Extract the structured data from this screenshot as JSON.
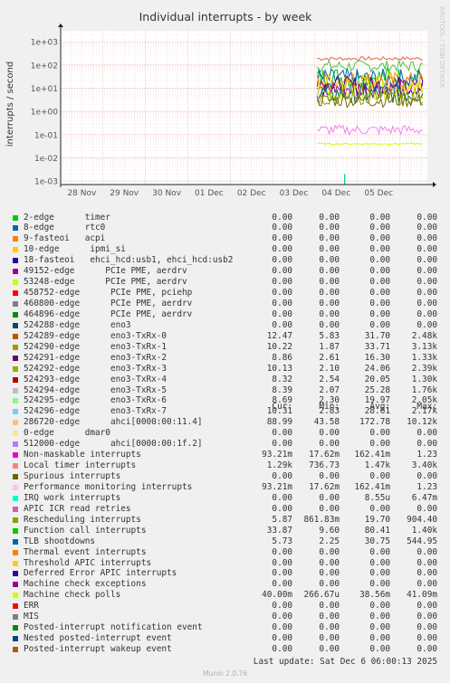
{
  "chart_data": {
    "type": "line",
    "title": "Individual interrupts - by week",
    "ylabel": "interrupts / second",
    "yscale": "log",
    "ylim": [
      0.0007,
      3000
    ],
    "yticks": [
      "1e+03",
      "1e+02",
      "1e+01",
      "1e+00",
      "1e-01",
      "1e-02",
      "1e-03"
    ],
    "ytick_values": [
      1000,
      100,
      10,
      1,
      0.1,
      0.01,
      0.001
    ],
    "xticks": [
      "28 Nov",
      "29 Nov",
      "30 Nov",
      "01 Dec",
      "02 Dec",
      "03 Dec",
      "04 Dec",
      "05 Dec"
    ],
    "x_day_range": [
      0,
      8.65
    ],
    "data_start_day": 6.05,
    "watermark": "RRDTOOL / TOBI OETIKER",
    "grid": true,
    "series": [
      {
        "level": 190,
        "spread": 0.08,
        "color": "#EA644A"
      },
      {
        "level": 90,
        "spread": 0.25,
        "color": "#4DC24D"
      },
      {
        "level": 30,
        "spread": 0.45,
        "color": "#00CC00"
      },
      {
        "level": 25,
        "spread": 0.45,
        "color": "#0066B3"
      },
      {
        "level": 20,
        "spread": 0.4,
        "color": "#FF8000"
      },
      {
        "level": 15,
        "spread": 0.45,
        "color": "#FFCC00"
      },
      {
        "level": 12,
        "spread": 0.45,
        "color": "#330099"
      },
      {
        "level": 10,
        "spread": 0.4,
        "color": "#990099"
      },
      {
        "level": 8,
        "spread": 0.4,
        "color": "#CCFF00"
      },
      {
        "level": 6,
        "spread": 0.45,
        "color": "#006666"
      },
      {
        "level": 4,
        "spread": 0.35,
        "color": "#999900"
      },
      {
        "level": 3,
        "spread": 0.3,
        "color": "#6E6E00"
      },
      {
        "level": 0.16,
        "spread": 0.22,
        "color": "#EE82EE"
      },
      {
        "level": 0.04,
        "spread": 0.03,
        "color": "#CCFF00"
      }
    ],
    "spike": {
      "day": 6.7,
      "value": 0.002,
      "color": "#00CC99"
    }
  },
  "legend": {
    "headers": [
      "Cur:",
      "Min:",
      "Avg:",
      "Max:"
    ],
    "rows": [
      {
        "name": "2-edge      timer",
        "color": "#00CC00",
        "cur": "0.00",
        "min": "0.00",
        "avg": "0.00",
        "max": "0.00"
      },
      {
        "name": "8-edge      rtc0",
        "color": "#0066B3",
        "cur": "0.00",
        "min": "0.00",
        "avg": "0.00",
        "max": "0.00"
      },
      {
        "name": "9-fasteoi   acpi",
        "color": "#FF8000",
        "cur": "0.00",
        "min": "0.00",
        "avg": "0.00",
        "max": "0.00"
      },
      {
        "name": "10-edge      ipmi_si",
        "color": "#FFCC00",
        "cur": "0.00",
        "min": "0.00",
        "avg": "0.00",
        "max": "0.00"
      },
      {
        "name": "18-fasteoi   ehci_hcd:usb1, ehci_hcd:usb2",
        "color": "#330099",
        "cur": "0.00",
        "min": "0.00",
        "avg": "0.00",
        "max": "0.00"
      },
      {
        "name": "49152-edge      PCIe PME, aerdrv",
        "color": "#990099",
        "cur": "0.00",
        "min": "0.00",
        "avg": "0.00",
        "max": "0.00"
      },
      {
        "name": "53248-edge      PCIe PME, aerdrv",
        "color": "#CCFF00",
        "cur": "0.00",
        "min": "0.00",
        "avg": "0.00",
        "max": "0.00"
      },
      {
        "name": "458752-edge      PCIe PME, pciehp",
        "color": "#FF0000",
        "cur": "0.00",
        "min": "0.00",
        "avg": "0.00",
        "max": "0.00"
      },
      {
        "name": "460800-edge      PCIe PME, aerdrv",
        "color": "#808080",
        "cur": "0.00",
        "min": "0.00",
        "avg": "0.00",
        "max": "0.00"
      },
      {
        "name": "464896-edge      PCIe PME, aerdrv",
        "color": "#008F00",
        "cur": "0.00",
        "min": "0.00",
        "avg": "0.00",
        "max": "0.00"
      },
      {
        "name": "524288-edge      eno3",
        "color": "#00487D",
        "cur": "0.00",
        "min": "0.00",
        "avg": "0.00",
        "max": "0.00"
      },
      {
        "name": "524289-edge      eno3-TxRx-0",
        "color": "#B35A00",
        "cur": "12.47",
        "min": "5.83",
        "avg": "31.70",
        "max": "2.48k"
      },
      {
        "name": "524290-edge      eno3-TxRx-1",
        "color": "#B38F00",
        "cur": "10.22",
        "min": "1.87",
        "avg": "33.71",
        "max": "3.13k"
      },
      {
        "name": "524291-edge      eno3-TxRx-2",
        "color": "#6B006B",
        "cur": "8.86",
        "min": "2.61",
        "avg": "16.30",
        "max": "1.33k"
      },
      {
        "name": "524292-edge      eno3-TxRx-3",
        "color": "#8FB300",
        "cur": "10.13",
        "min": "2.10",
        "avg": "24.06",
        "max": "2.39k"
      },
      {
        "name": "524293-edge      eno3-TxRx-4",
        "color": "#B30000",
        "cur": "8.32",
        "min": "2.54",
        "avg": "20.05",
        "max": "1.30k"
      },
      {
        "name": "524294-edge      eno3-TxRx-5",
        "color": "#BEBEBE",
        "cur": "8.39",
        "min": "2.07",
        "avg": "25.28",
        "max": "1.76k"
      },
      {
        "name": "524295-edge      eno3-TxRx-6",
        "color": "#80FF80",
        "cur": "8.69",
        "min": "2.30",
        "avg": "19.97",
        "max": "2.05k"
      },
      {
        "name": "524296-edge      eno3-TxRx-7",
        "color": "#80C9FF",
        "cur": "10.31",
        "min": "2.83",
        "avg": "28.61",
        "max": "2.17k"
      },
      {
        "name": "286720-edge      ahci[0000:00:11.4]",
        "color": "#FFC080",
        "cur": "88.99",
        "min": "43.58",
        "avg": "172.78",
        "max": "10.12k"
      },
      {
        "name": "0-edge      dmar0",
        "color": "#FFE680",
        "cur": "0.00",
        "min": "0.00",
        "avg": "0.00",
        "max": "0.00"
      },
      {
        "name": "512000-edge      ahci[0000:00:1f.2]",
        "color": "#AA80FF",
        "cur": "0.00",
        "min": "0.00",
        "avg": "0.00",
        "max": "0.00"
      },
      {
        "name": "Non-maskable interrupts",
        "color": "#EE00CC",
        "cur": "93.21m",
        "min": "17.62m",
        "avg": "162.41m",
        "max": "1.23"
      },
      {
        "name": "Local timer interrupts",
        "color": "#FF8080",
        "cur": "1.29k",
        "min": "736.73",
        "avg": "1.47k",
        "max": "3.40k"
      },
      {
        "name": "Spurious interrupts",
        "color": "#666600",
        "cur": "0.00",
        "min": "0.00",
        "avg": "0.00",
        "max": "0.00"
      },
      {
        "name": "Performance monitoring interrupts",
        "color": "#FFBFFF",
        "cur": "93.21m",
        "min": "17.62m",
        "avg": "162.41m",
        "max": "1.23"
      },
      {
        "name": "IRQ work interrupts",
        "color": "#00FFCC",
        "cur": "0.00",
        "min": "0.00",
        "avg": "8.55u",
        "max": "6.47m"
      },
      {
        "name": "APIC ICR read retries",
        "color": "#CC6699",
        "cur": "0.00",
        "min": "0.00",
        "avg": "0.00",
        "max": "0.00"
      },
      {
        "name": "Rescheduling interrupts",
        "color": "#999900",
        "cur": "5.87",
        "min": "861.83m",
        "avg": "19.70",
        "max": "904.40"
      },
      {
        "name": "Function call interrupts",
        "color": "#00CC00",
        "cur": "33.87",
        "min": "9.60",
        "avg": "80.41",
        "max": "1.40k"
      },
      {
        "name": "TLB shootdowns",
        "color": "#0066B3",
        "cur": "5.73",
        "min": "2.25",
        "avg": "30.75",
        "max": "544.95"
      },
      {
        "name": "Thermal event interrupts",
        "color": "#FF8000",
        "cur": "0.00",
        "min": "0.00",
        "avg": "0.00",
        "max": "0.00"
      },
      {
        "name": "Threshold APIC interrupts",
        "color": "#FFCC00",
        "cur": "0.00",
        "min": "0.00",
        "avg": "0.00",
        "max": "0.00"
      },
      {
        "name": "Deferred Error APIC interrupts",
        "color": "#330099",
        "cur": "0.00",
        "min": "0.00",
        "avg": "0.00",
        "max": "0.00"
      },
      {
        "name": "Machine check exceptions",
        "color": "#990099",
        "cur": "0.00",
        "min": "0.00",
        "avg": "0.00",
        "max": "0.00"
      },
      {
        "name": "Machine check polls",
        "color": "#CCFF00",
        "cur": "40.00m",
        "min": "266.67u",
        "avg": "38.56m",
        "max": "41.09m"
      },
      {
        "name": "ERR",
        "color": "#FF0000",
        "cur": "0.00",
        "min": "0.00",
        "avg": "0.00",
        "max": "0.00"
      },
      {
        "name": "MIS",
        "color": "#808080",
        "cur": "0.00",
        "min": "0.00",
        "avg": "0.00",
        "max": "0.00"
      },
      {
        "name": "Posted-interrupt notification event",
        "color": "#008F00",
        "cur": "0.00",
        "min": "0.00",
        "avg": "0.00",
        "max": "0.00"
      },
      {
        "name": "Nested posted-interrupt event",
        "color": "#00487D",
        "cur": "0.00",
        "min": "0.00",
        "avg": "0.00",
        "max": "0.00"
      },
      {
        "name": "Posted-interrupt wakeup event",
        "color": "#B35A00",
        "cur": "0.00",
        "min": "0.00",
        "avg": "0.00",
        "max": "0.00"
      }
    ]
  },
  "footer": {
    "last_update": "Last update: Sat Dec  6 06:00:13 2025",
    "munin": "Munin 2.0.76"
  }
}
